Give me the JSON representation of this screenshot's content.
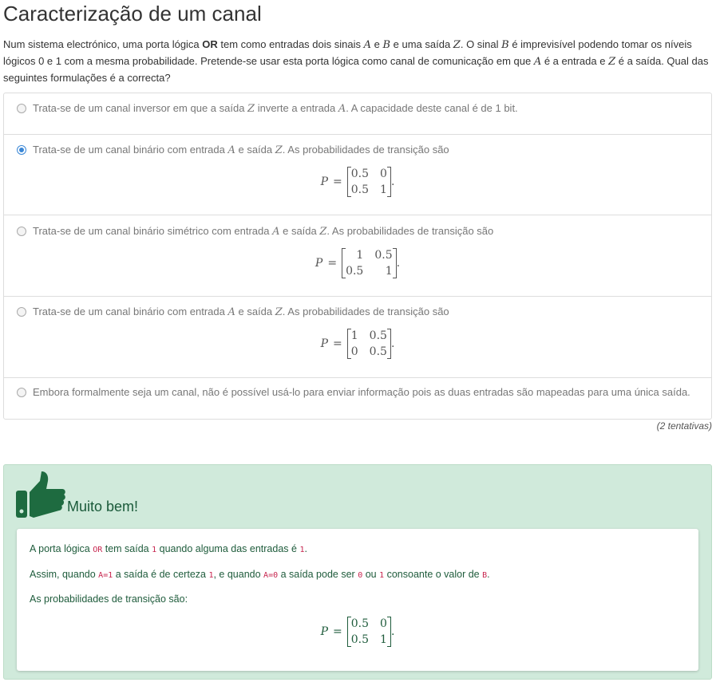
{
  "page": {
    "title": "Caracterização de um canal",
    "intro": {
      "p1": "Num sistema electrónico, uma porta lógica ",
      "bold": "OR",
      "p2": " tem como entradas dois sinais ",
      "A": "A",
      "p3": " e ",
      "B": "B",
      "p4": " e uma saída ",
      "Z": "Z",
      "p5": ". O sinal ",
      "B2": "B",
      "p6": " é imprevisível podendo tomar os níveis lógicos 0 e 1 com a mesma probabilidade. Pretende-se usar esta porta lógica como canal de comunicação em que ",
      "A2": "A",
      "p7": " é a entrada e ",
      "Z2": "Z",
      "p8": " é a saída. Qual das seguintes formulações é a correcta?"
    }
  },
  "options": [
    {
      "selected": false,
      "t1": "Trata-se de um canal inversor em que a saída ",
      "v1": "Z",
      "t2": " inverte a entrada ",
      "v2": "A",
      "t3": ". A capacidade deste canal é de 1 bit."
    },
    {
      "selected": true,
      "t1": "Trata-se de um canal binário com entrada ",
      "v1": "A",
      "t2": " e saída ",
      "v2": "Z",
      "t3": ". As probabilidades de transição são",
      "matrix": [
        "0.5",
        "0",
        "0.5",
        "1"
      ]
    },
    {
      "selected": false,
      "t1": "Trata-se de um canal binário simétrico com entrada ",
      "v1": "A",
      "t2": " e saída ",
      "v2": "Z",
      "t3": ". As probabilidades de transição são",
      "matrix": [
        "1",
        "0.5",
        "0.5",
        "1"
      ]
    },
    {
      "selected": false,
      "t1": "Trata-se de um canal binário com entrada ",
      "v1": "A",
      "t2": " e saída ",
      "v2": "Z",
      "t3": ". As probabilidades de transição são",
      "matrix": [
        "1",
        "0.5",
        "0",
        "0.5"
      ]
    },
    {
      "selected": false,
      "t1": "Embora formalmente seja um canal, não é possível usá-lo para enviar informação pois as duas entradas são mapeadas para uma única saída."
    }
  ],
  "matrix_lhs": "P",
  "matrix_eq": "=",
  "matrix_end": ".",
  "attempts": "(2 tentativas)",
  "feedback": {
    "title": "Muito bem!",
    "l1a": "A porta lógica ",
    "l1c1": "OR",
    "l1b": " tem saída ",
    "l1c2": "1",
    "l1d": " quando alguma das entradas é ",
    "l1c3": "1",
    "l1e": ".",
    "l2a": "Assim, quando ",
    "l2c1": "A=1",
    "l2b": " a saída é de certeza ",
    "l2c2": "1",
    "l2c": ", e quando ",
    "l2c3": "A=0",
    "l2d": " a saída pode ser ",
    "l2c4": "0",
    "l2e": " ou ",
    "l2c5": "1",
    "l2f": " consoante o valor de ",
    "l2c6": "B",
    "l2g": ".",
    "l3": "As probabilidades de transição são:",
    "matrix": [
      "0.5",
      "0",
      "0.5",
      "1"
    ]
  },
  "colors": {
    "accent": "#3a87d6",
    "success_bg": "#d0eadb",
    "success_text": "#1f5c3c",
    "thumb": "#1e6b40"
  }
}
